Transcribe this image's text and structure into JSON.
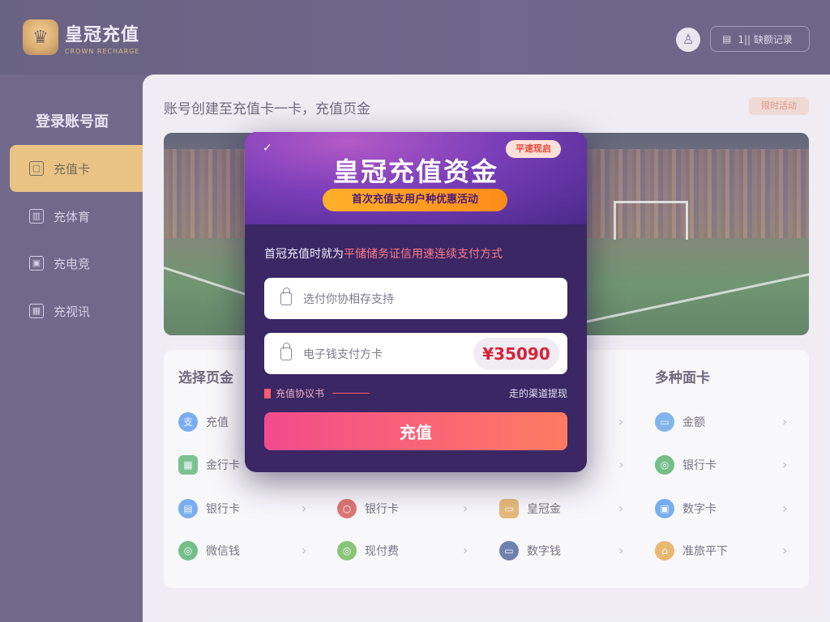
{
  "brand": {
    "logo_text": "皇冠充值",
    "logo_sub": "CROWN RECHARGE"
  },
  "topbar": {
    "avatar_icon": "user-icon",
    "button_label": "1|| 缺额记录"
  },
  "sidebar": {
    "title": "登录账号面",
    "items": [
      {
        "label": "充值卡",
        "icon": "wallet-icon",
        "active": true
      },
      {
        "label": "充体育",
        "icon": "card-icon",
        "active": false
      },
      {
        "label": "充电竞",
        "icon": "screen-icon",
        "active": false
      },
      {
        "label": "充视讯",
        "icon": "video-icon",
        "active": false
      }
    ]
  },
  "main": {
    "heading": "账号创建至充值卡一卡，充值页金",
    "pill": "限时活动"
  },
  "payments": {
    "col1_title": "选择页金",
    "col4_title": "多种面卡",
    "col4_title_hl": "卡",
    "rows": [
      [
        {
          "label": "充值",
          "icon": "alipay-icon",
          "color": "#3b8ff0"
        },
        {
          "label": "金额",
          "icon": "wallet-icon",
          "color": "#4a9ae8"
        }
      ],
      [
        {
          "label": "金行卡",
          "icon": "grid-icon",
          "color": "#3fae5c"
        },
        {
          "label": "银行卡",
          "icon": "wechat-icon",
          "color": "#35a853"
        }
      ],
      [
        {
          "label": "银行卡",
          "icon": "card-icon",
          "color": "#3b8ff0"
        },
        {
          "label": "银行卡",
          "icon": "unionpay-icon",
          "color": "#d83a32"
        },
        {
          "label": "皇冠金",
          "icon": "coin-icon",
          "color": "#e3a23a"
        },
        {
          "label": "数字卡",
          "icon": "bank-icon",
          "color": "#3b8ff0"
        }
      ],
      [
        {
          "label": "微信钱",
          "icon": "wechat-icon",
          "color": "#35a853"
        },
        {
          "label": "现付费",
          "icon": "wechat-icon",
          "color": "#55b23a"
        },
        {
          "label": "数字钱",
          "icon": "wallet-icon",
          "color": "#2b4a8c"
        },
        {
          "label": "准旅平下",
          "icon": "shop-icon",
          "color": "#e79e2e"
        }
      ]
    ]
  },
  "modal": {
    "check_icon": "check-icon",
    "tag": "平速现启",
    "title": "皇冠充值资金",
    "promo": "首次充值支用户种优惠活动",
    "notice_plain": "首冠充值时就为",
    "notice_hl": "平储储务证信用速连续支付方式",
    "field1_placeholder": "选付你协相存支持",
    "field2_placeholder": "电子钱支付方卡",
    "amount": "¥35090",
    "link_left": "充值协议书",
    "link_right": "走的渠道提现",
    "submit_label": "充值"
  }
}
